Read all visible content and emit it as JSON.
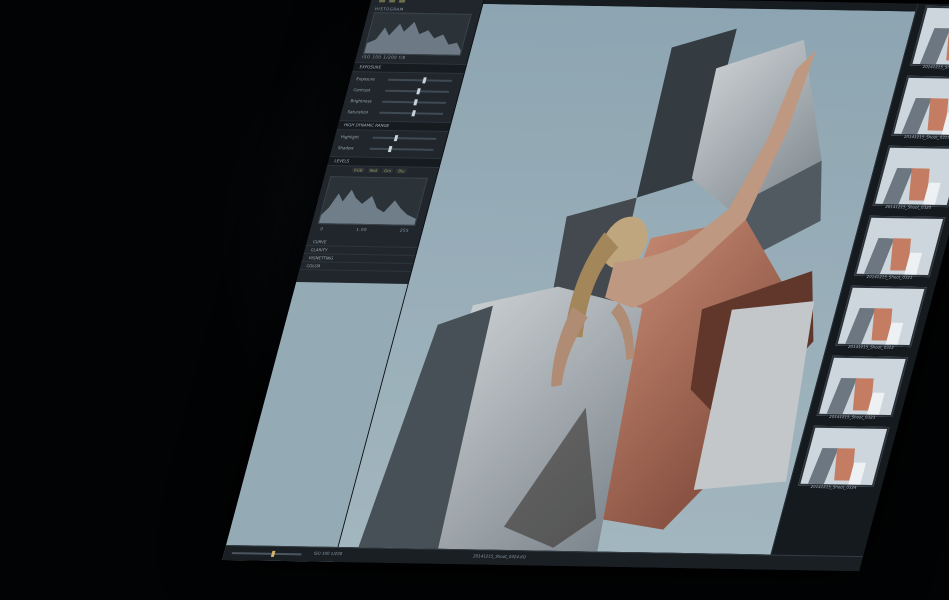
{
  "panel": {
    "histogram_label": "HISTOGRAM",
    "histogram_stats": "ISO 100   1/200   f/8",
    "exposure_section": "EXPOSURE",
    "sliders": [
      {
        "label": "Exposure",
        "value": 0.55
      },
      {
        "label": "Contrast",
        "value": 0.5
      },
      {
        "label": "Brightness",
        "value": 0.5
      },
      {
        "label": "Saturation",
        "value": 0.52
      }
    ],
    "hdr_section": "HIGH DYNAMIC RANGE",
    "hdr_sliders": [
      {
        "label": "Highlight",
        "value": 0.35
      },
      {
        "label": "Shadow",
        "value": 0.3
      }
    ],
    "levels_section": "LEVELS",
    "levels_tabs": [
      "RGB",
      "Red",
      "Grn",
      "Blu"
    ],
    "levels_values": [
      "0",
      "1.00",
      "255"
    ],
    "collapsed_sections": [
      "CURVE",
      "CLARITY",
      "VIGNETTING",
      "COLOR"
    ]
  },
  "bottom_bar": {
    "zoom_label": "ISO 100     1/200",
    "file_label": "20141215_Shoot_0324.IIQ"
  },
  "filmstrip": {
    "captions": [
      "20141215_Shoot_0318",
      "20141215_Shoot_0319",
      "20141215_Shoot_0320",
      "20141215_Shoot_0321",
      "20141215_Shoot_0322",
      "20141215_Shoot_0323",
      "20141215_Shoot_0324"
    ]
  }
}
